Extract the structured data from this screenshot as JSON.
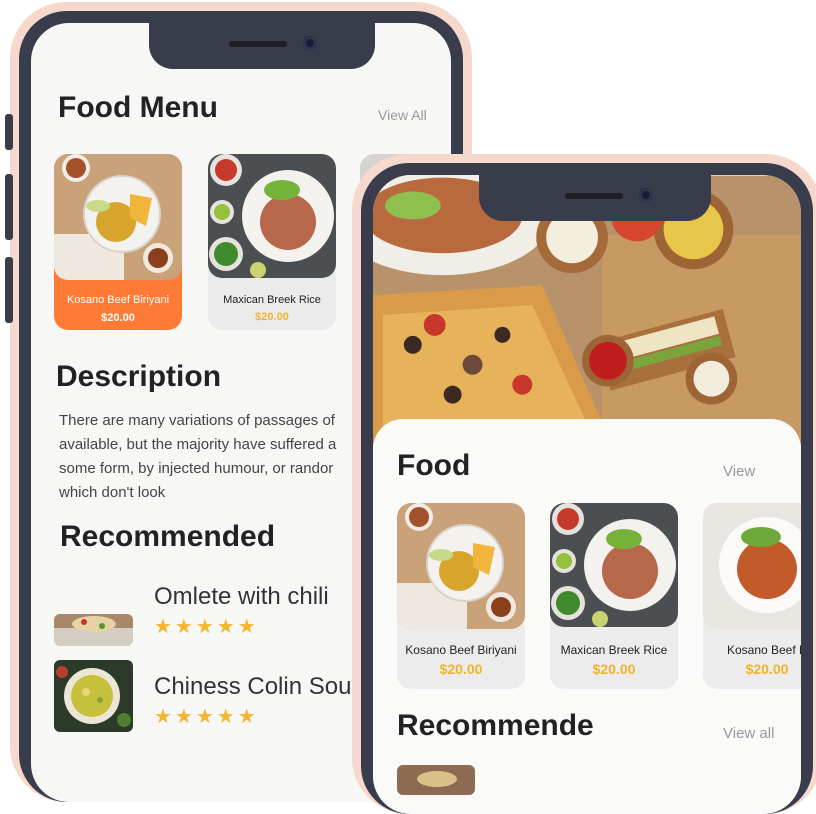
{
  "colors": {
    "accent_orange": "#ff7b35",
    "star_gold": "#f3b62f",
    "price_gold": "#f0b429",
    "frame_dark": "#383c4b",
    "frame_peach": "#f6d9cc"
  },
  "phone1": {
    "menu": {
      "title": "Food Menu",
      "view_all": "View All",
      "items": [
        {
          "name": "Kosano Beef Biriyani",
          "price": "$20.00"
        },
        {
          "name": "Maxican Breek Rice",
          "price": "$20.00"
        }
      ]
    },
    "description": {
      "title": "Description",
      "lines": [
        "There are many variations of passages of",
        "available, but the majority have suffered a",
        "some form, by injected humour, or randor",
        "which don't look"
      ]
    },
    "recommended": {
      "title": "Recommended",
      "items": [
        {
          "title": "Omlete with chili",
          "stars": "★★★★★",
          "rating": 5
        },
        {
          "title": "Chiness Colin Sou",
          "stars": "★★★★★",
          "rating": 5
        }
      ]
    }
  },
  "phone2": {
    "food": {
      "title": "Food",
      "view": "View",
      "items": [
        {
          "name": "Kosano Beef Biriyani",
          "price": "$20.00"
        },
        {
          "name": "Maxican Breek Rice",
          "price": "$20.00"
        },
        {
          "name": "Kosano Beef B",
          "price": "$20.00"
        }
      ]
    },
    "recommended": {
      "title": "Recommende",
      "view_all": "View all"
    }
  }
}
